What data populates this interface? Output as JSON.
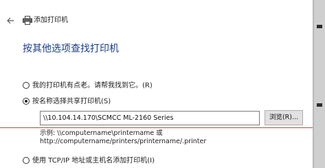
{
  "window": {
    "title": "添加打印机",
    "icons": {
      "back": "back-arrow-icon",
      "printer": "printer-icon"
    }
  },
  "heading": "按其他选项查找打印机",
  "options": [
    {
      "label": "我的打印机有点老。请帮我找到它。(R)",
      "checked": false
    },
    {
      "label": "按名称选择共享打印机(S)",
      "checked": true
    },
    {
      "label": "使用 TCP/IP 地址或主机名添加打印机(I)",
      "checked": false
    }
  ],
  "shared_printer": {
    "value": "\\\\10.104.14.170\\SCMCC ML-2160 Series",
    "browse_label": "浏览(R)...",
    "example_line1": "示例: \\\\computername\\printername 或",
    "example_line2": "http://computername/printers/printername/.printer"
  },
  "colors": {
    "heading": "#1a3c8f",
    "annotation_line": "#d93a3a"
  }
}
